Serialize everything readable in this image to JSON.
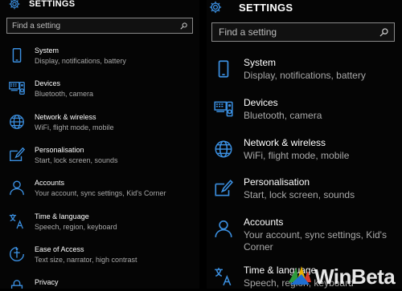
{
  "header": {
    "title": "SETTINGS",
    "icon": "gear-icon"
  },
  "search": {
    "placeholder": "Find a setting",
    "icon": "search-icon"
  },
  "items": [
    {
      "id": "system",
      "icon": "phone-icon",
      "title": "System",
      "subtitle": "Display, notifications, battery"
    },
    {
      "id": "devices",
      "icon": "devices-icon",
      "title": "Devices",
      "subtitle": "Bluetooth, camera"
    },
    {
      "id": "network",
      "icon": "globe-icon",
      "title": "Network & wireless",
      "subtitle": "WiFi, flight mode, mobile"
    },
    {
      "id": "personalisation",
      "icon": "personalisation-icon",
      "title": "Personalisation",
      "subtitle": "Start, lock screen, sounds"
    },
    {
      "id": "accounts",
      "icon": "person-icon",
      "title": "Accounts",
      "subtitle": "Your account, sync settings, Kid's Corner"
    },
    {
      "id": "time-language",
      "icon": "time-language-icon",
      "title": "Time & language",
      "subtitle": "Speech, region, keyboard"
    },
    {
      "id": "ease-of-access",
      "icon": "ease-of-access-icon",
      "title": "Ease of Access",
      "subtitle": "Text size, narrator, high contrast"
    },
    {
      "id": "privacy",
      "icon": "lock-icon",
      "title": "Privacy",
      "subtitle": ""
    }
  ],
  "watermark": {
    "text": "WinBeta"
  },
  "colors": {
    "accent": "#3b8fe0",
    "background": "#050505",
    "subtitle": "#a8a8a8"
  }
}
